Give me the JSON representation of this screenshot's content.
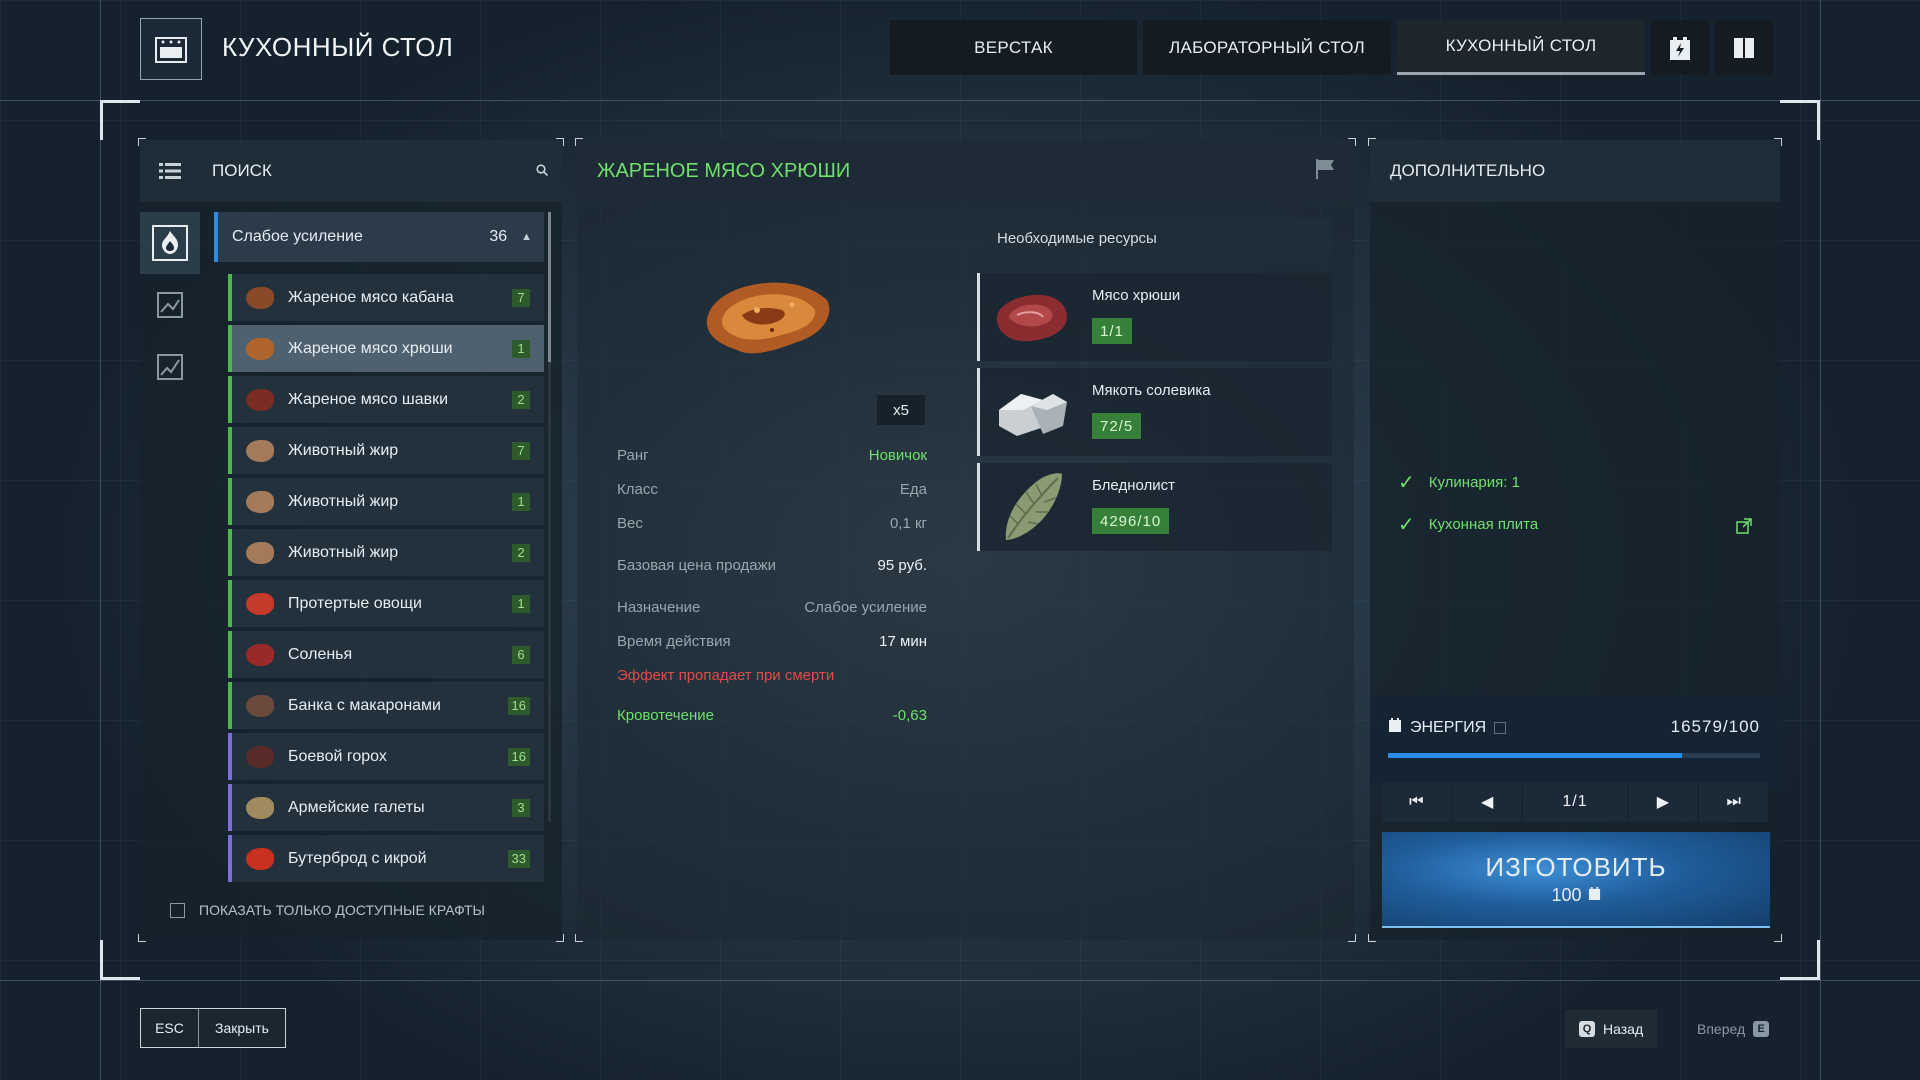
{
  "header": {
    "title": "КУХОННЫЙ СТОЛ",
    "tabs": [
      {
        "label": "ВЕРСТАК"
      },
      {
        "label": "ЛАБОРАТОРНЫЙ СТОЛ"
      },
      {
        "label": "КУХОННЫЙ СТОЛ",
        "active": true
      }
    ]
  },
  "search": {
    "label": "ПОИСК"
  },
  "group": {
    "label": "Слабое усиление",
    "count": "36"
  },
  "recipes": [
    {
      "name": "Жареное мясо кабана",
      "count": "7",
      "color": "#8a4a2a",
      "tier": "green"
    },
    {
      "name": "Жареное мясо хрюши",
      "count": "1",
      "color": "#b0652e",
      "tier": "green",
      "active": true
    },
    {
      "name": "Жареное мясо шавки",
      "count": "2",
      "color": "#7a2c22",
      "tier": "green"
    },
    {
      "name": "Животный жир",
      "count": "7",
      "color": "#a57a5a",
      "tier": "green"
    },
    {
      "name": "Животный жир",
      "count": "1",
      "color": "#a57a5a",
      "tier": "green"
    },
    {
      "name": "Животный жир",
      "count": "2",
      "color": "#a57a5a",
      "tier": "green"
    },
    {
      "name": "Протертые овощи",
      "count": "1",
      "color": "#c53a2a",
      "tier": "green"
    },
    {
      "name": "Соленья",
      "count": "6",
      "color": "#9a2a2a",
      "tier": "green"
    },
    {
      "name": "Банка с макаронами",
      "count": "16",
      "color": "#6a4a3a",
      "tier": "green"
    },
    {
      "name": "Боевой горох",
      "count": "16",
      "color": "#5a2a28",
      "tier": "blue"
    },
    {
      "name": "Армейские галеты",
      "count": "3",
      "color": "#a08a60",
      "tier": "blue"
    },
    {
      "name": "Бутерброд с икрой",
      "count": "33",
      "color": "#c83020",
      "tier": "blue"
    }
  ],
  "only_available_label": "ПОКАЗАТЬ ТОЛЬКО ДОСТУПНЫЕ КРАФТЫ",
  "item": {
    "title": "ЖАРЕНОЕ МЯСО ХРЮШИ",
    "quantity": "x5",
    "rank_label": "Ранг",
    "rank_value": "Новичок",
    "class_label": "Класс",
    "class_value": "Еда",
    "weight_label": "Вес",
    "weight_value": "0,1 кг",
    "price_label": "Базовая цена продажи",
    "price_value": "95 руб.",
    "purpose_label": "Назначение",
    "purpose_value": "Слабое усиление",
    "duration_label": "Время действия",
    "duration_value": "17 мин",
    "death_warning": "Эффект пропадает при смерти",
    "bleed_label": "Кровотечение",
    "bleed_value": "-0,63"
  },
  "resources": {
    "title": "Необходимые ресурсы",
    "items": [
      {
        "name": "Мясо хрюши",
        "amount": "1/1"
      },
      {
        "name": "Мякоть солевика",
        "amount": "72/5"
      },
      {
        "name": "Бледнолист",
        "amount": "4296/10"
      }
    ]
  },
  "extra": {
    "title": "ДОПОЛНИТЕЛЬНО",
    "requirements": [
      {
        "label": "Кулинария: 1"
      },
      {
        "label": "Кухонная плита"
      }
    ]
  },
  "energy": {
    "label": "ЭНЕРГИЯ",
    "value": "16579/100",
    "fill_fraction": 0.79
  },
  "pager": {
    "label": "1/1"
  },
  "craft": {
    "label": "ИЗГОТОВИТЬ",
    "cost": "100"
  },
  "footer": {
    "esc_key": "ESC",
    "close_label": "Закрыть",
    "back_key": "Q",
    "back_label": "Назад",
    "forward_label": "Вперед",
    "forward_key": "E"
  }
}
